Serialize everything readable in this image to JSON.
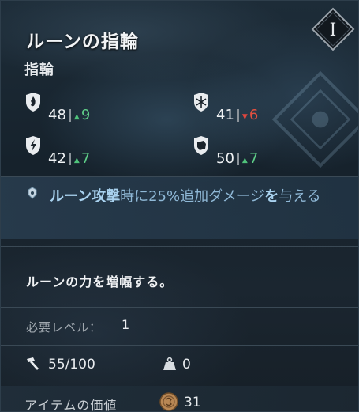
{
  "item": {
    "name": "ルーンの指輪",
    "type": "指輪",
    "tier": "I"
  },
  "stats": [
    {
      "icon": "slash-damage-shield-icon",
      "value": "48",
      "delta": "9",
      "trend": "up"
    },
    {
      "icon": "frost-shield-icon",
      "value": "41",
      "delta": "6",
      "trend": "down"
    },
    {
      "icon": "lightning-shield-icon",
      "value": "42",
      "delta": "7",
      "trend": "up"
    },
    {
      "icon": "fist-shield-icon",
      "value": "50",
      "delta": "7",
      "trend": "up"
    }
  ],
  "effect": {
    "icon": "rune-gem-icon",
    "highlight": "ルーン攻撃",
    "text_mid": "時に25%追加ダメージ",
    "text_particle": "を",
    "text_end": "与える"
  },
  "description": "ルーンの力を増幅する。",
  "requirement": {
    "label": "必要レベル：",
    "value": "1"
  },
  "durability": {
    "icon": "hammer-icon",
    "value": "55/100"
  },
  "weight": {
    "icon": "weight-icon",
    "value": "0"
  },
  "item_value": {
    "label": "アイテムの価値",
    "icon": "coin-icon",
    "value": "31"
  },
  "colors": {
    "positive": "#5fcf88",
    "negative": "#e5503f",
    "effect_text": "#8fb8d6"
  }
}
